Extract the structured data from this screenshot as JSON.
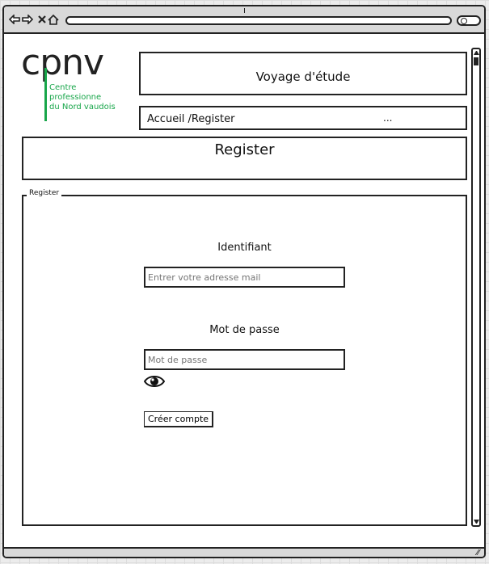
{
  "browser": {
    "back_icon": "arrow-left-icon",
    "forward_icon": "arrow-right-icon",
    "close_icon": "close-icon",
    "home_icon": "home-icon",
    "url": "",
    "search_icon": "search-icon"
  },
  "logo": {
    "wordmark": "cpnv",
    "subtitle": "Centre professionne\ndu Nord vaudois",
    "brand_color": "#18a64a"
  },
  "header": {
    "title": "Voyage d'étude"
  },
  "breadcrumb": {
    "path": "Accueil  /Register",
    "ellipsis": "..."
  },
  "page": {
    "title": "Register"
  },
  "register_form": {
    "legend": "Register",
    "identifier_label": "Identifiant",
    "identifier_placeholder": "Entrer votre adresse mail",
    "identifier_value": "",
    "password_label": "Mot de passe",
    "password_placeholder": "Mot de passe",
    "password_value": "",
    "show_password_icon": "eye-icon",
    "submit_label": "Créer compte"
  }
}
